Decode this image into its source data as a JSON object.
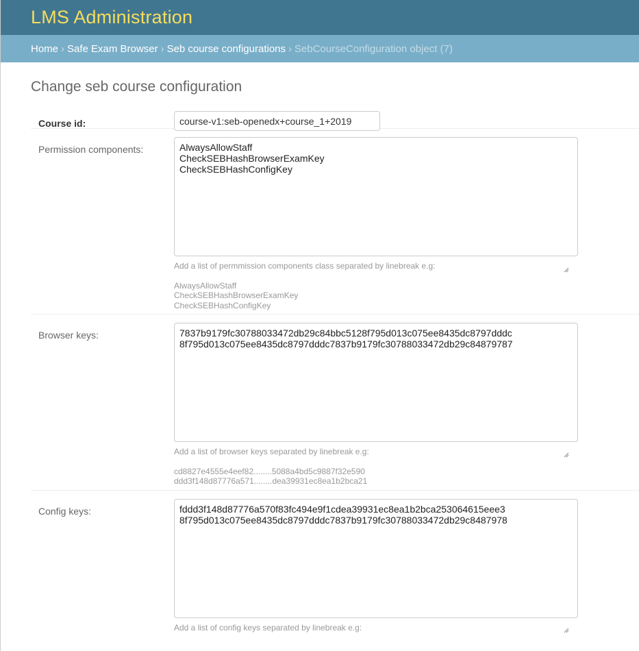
{
  "header": {
    "site_name": "LMS Administration"
  },
  "breadcrumbs": {
    "home": "Home",
    "app": "Safe Exam Browser",
    "model": "Seb course configurations",
    "current": "SebCourseConfiguration object (7)",
    "separator": "›"
  },
  "page_title": "Change seb course configuration",
  "fields": {
    "course_id": {
      "label": "Course id:",
      "value": "course-v1:seb-openedx+course_1+2019"
    },
    "permission_components": {
      "label": "Permission components:",
      "value": "AlwaysAllowStaff\nCheckSEBHashBrowserExamKey\nCheckSEBHashConfigKey",
      "help": "Add a list of permmission components class separated by linebreak e.g:",
      "examples": [
        "AlwaysAllowStaff",
        "CheckSEBHashBrowserExamKey",
        "CheckSEBHashConfigKey"
      ]
    },
    "browser_keys": {
      "label": "Browser keys:",
      "value": "7837b9179fc30788033472db29c84bbc5128f795d013c075ee8435dc8797dddc\n8f795d013c075ee8435dc8797dddc7837b9179fc30788033472db29c84879787",
      "help": "Add a list of browser keys separated by linebreak e.g:",
      "examples": [
        "cd8827e4555e4eef82........5088a4bd5c9887f32e590",
        "ddd3f148d87776a571........dea39931ec8ea1b2bca21"
      ]
    },
    "config_keys": {
      "label": "Config keys:",
      "value": "fddd3f148d87776a570f83fc494e9f1cdea39931ec8ea1b2bca253064615eee3\n8f795d013c075ee8435dc8797dddc7837b9179fc30788033472db29c8487978",
      "help": "Add a list of config keys separated by linebreak e.g:"
    }
  },
  "colors": {
    "header_bg": "#417690",
    "site_name": "#f5dd5d",
    "breadcrumbs_bg": "#79aec8"
  }
}
